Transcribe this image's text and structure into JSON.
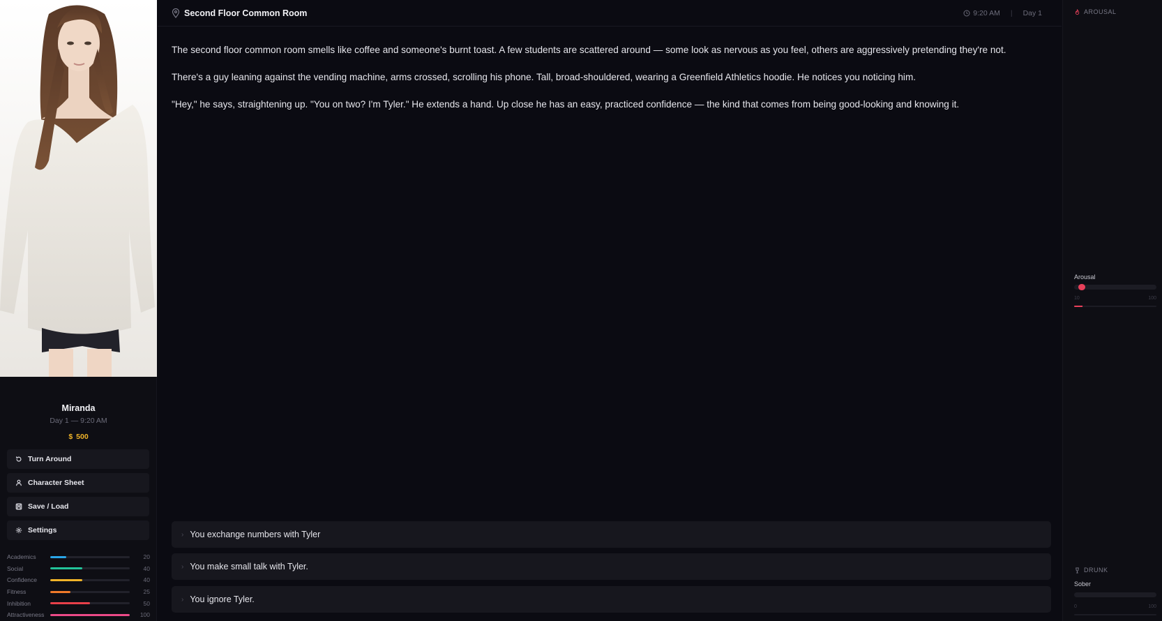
{
  "sidebar": {
    "character_name": "Miranda",
    "character_time": "Day 1 — 9:20 AM",
    "money_symbol": "$",
    "money": "500",
    "buttons": [
      {
        "label": "Turn Around",
        "icon": "rotate-icon"
      },
      {
        "label": "Character Sheet",
        "icon": "person-icon"
      },
      {
        "label": "Save / Load",
        "icon": "save-icon"
      },
      {
        "label": "Settings",
        "icon": "gear-icon"
      }
    ],
    "stats": [
      {
        "label": "Academics",
        "value": "20",
        "color": "#2aa6e8"
      },
      {
        "label": "Social",
        "value": "40",
        "color": "#22c39a"
      },
      {
        "label": "Confidence",
        "value": "40",
        "color": "#f0b429"
      },
      {
        "label": "Fitness",
        "value": "25",
        "color": "#f07a2a"
      },
      {
        "label": "Inhibition",
        "value": "50",
        "color": "#e8404a"
      },
      {
        "label": "Attractiveness",
        "value": "100",
        "color": "#ec4a88"
      }
    ]
  },
  "header": {
    "location": "Second Floor Common Room",
    "time": "9:20 AM",
    "day": "Day 1"
  },
  "story": {
    "paragraphs": [
      "The second floor common room smells like coffee and someone's burnt toast. A few students are scattered around — some look as nervous as you feel, others are aggressively pretending they're not.",
      "There's a guy leaning against the vending machine, arms crossed, scrolling his phone. Tall, broad-shouldered, wearing a Greenfield Athletics hoodie. He notices you noticing him.",
      "\"Hey,\" he says, straightening up. \"You on two? I'm Tyler.\" He extends a hand. Up close he has an easy, practiced confidence — the kind that comes from being good-looking and knowing it."
    ]
  },
  "choices": [
    {
      "label": "You exchange numbers with Tyler"
    },
    {
      "label": "You make small talk with Tyler."
    },
    {
      "label": "You ignore Tyler."
    }
  ],
  "right_panel": {
    "arousal_title": "AROUSAL",
    "arousal_label": "Arousal",
    "arousal_value": "10",
    "arousal_max": "100",
    "arousal_fraction": 0.1,
    "arousal_color": "#e8405a",
    "drunk_title": "DRUNK",
    "drunk_label": "Sober",
    "drunk_value": "0",
    "drunk_max": "100",
    "drunk_fraction": 0
  }
}
